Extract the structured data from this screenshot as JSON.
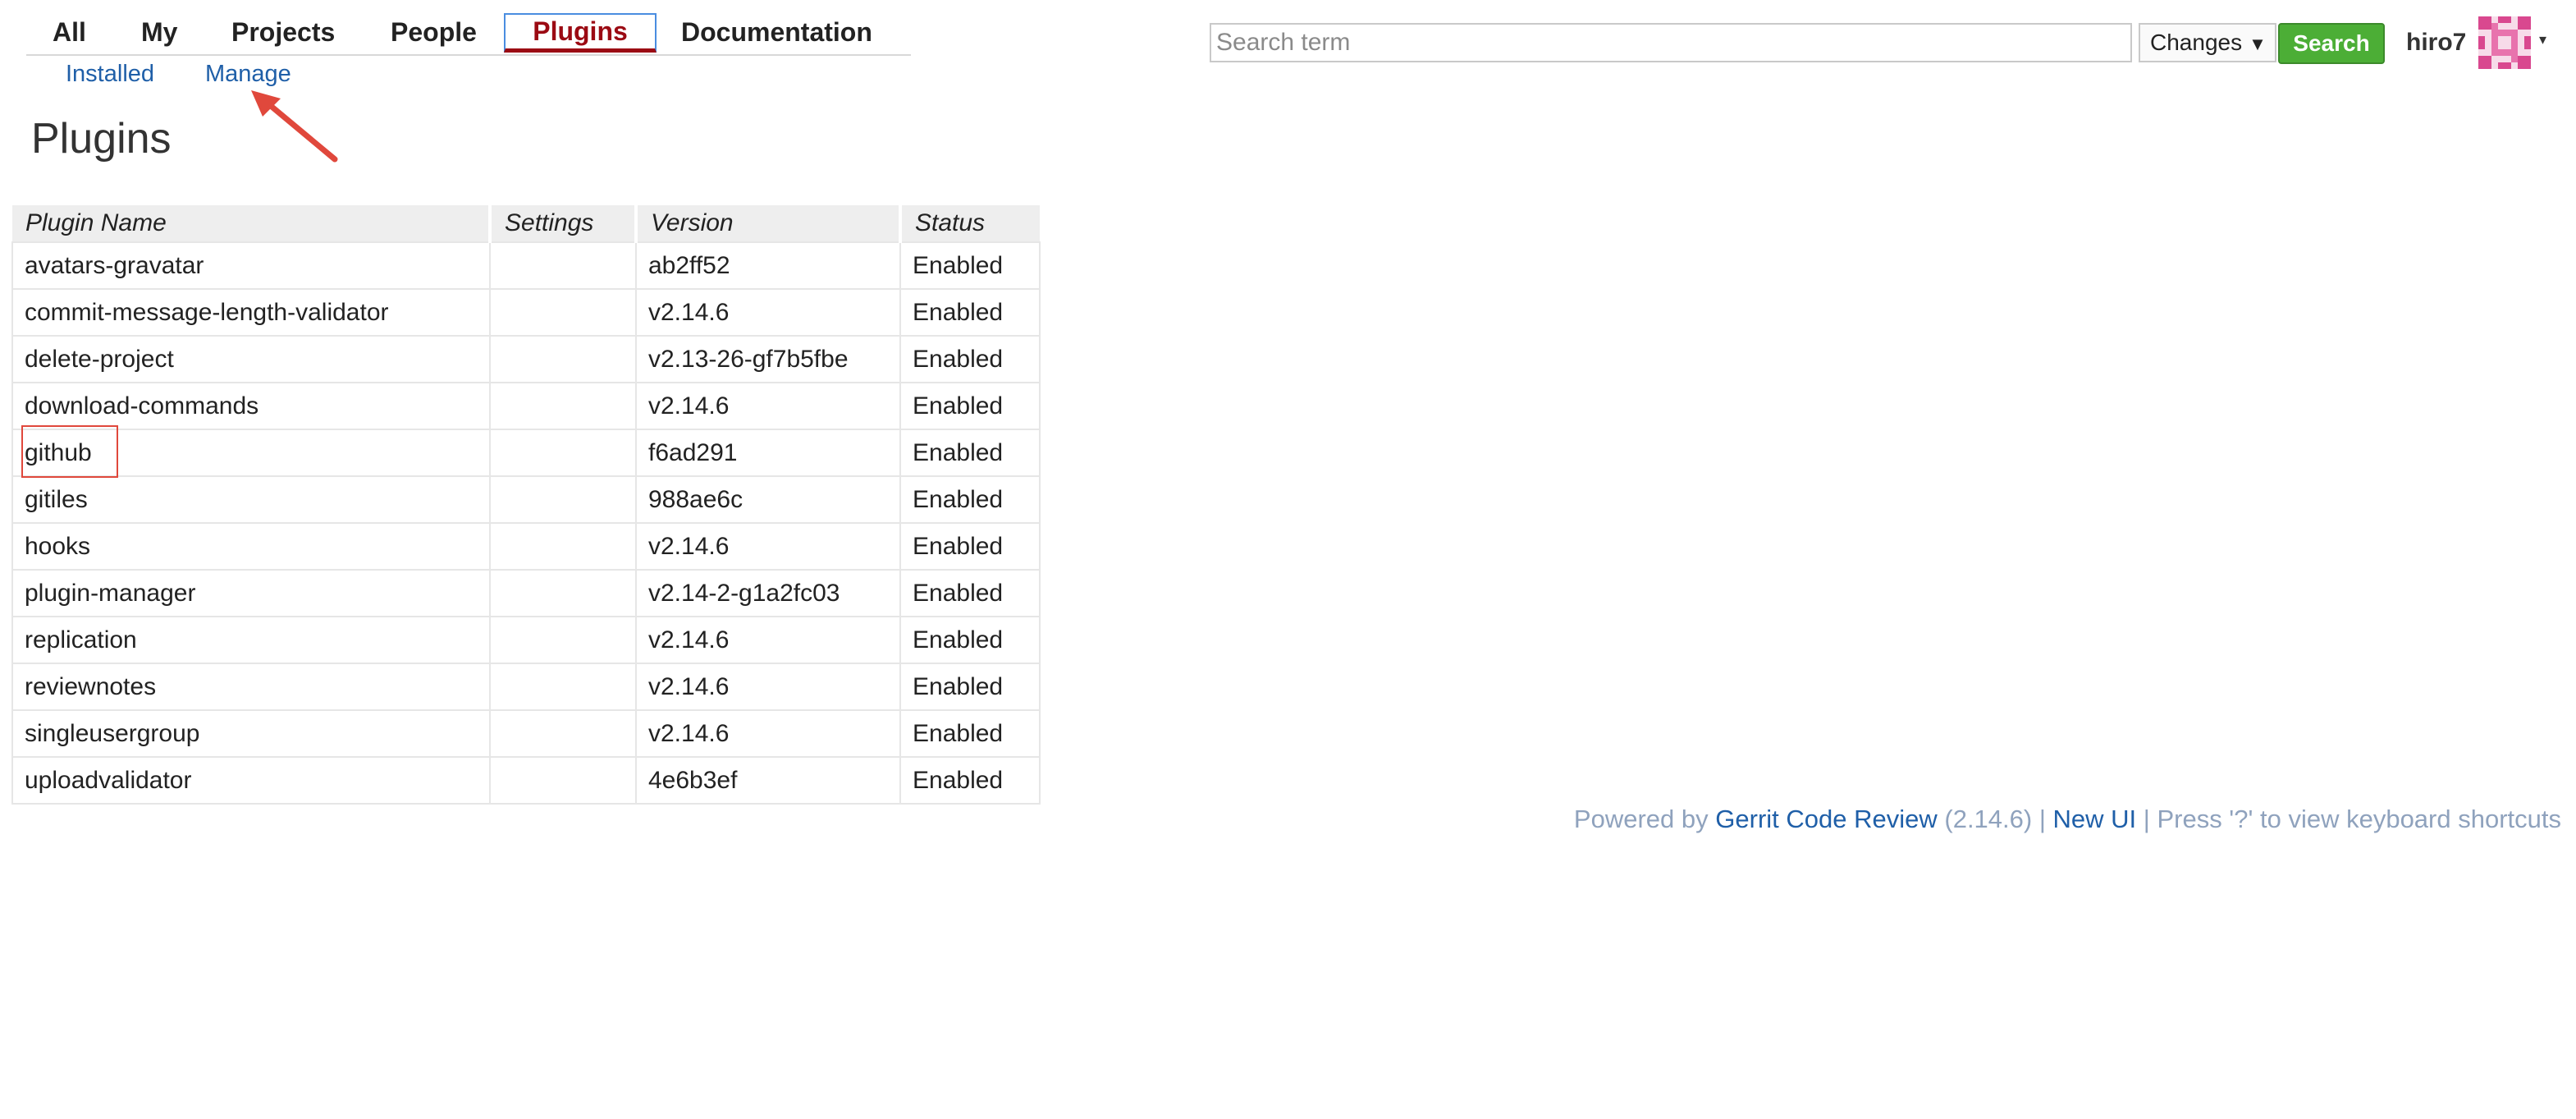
{
  "topmenu": {
    "items": [
      "All",
      "My",
      "Projects",
      "People",
      "Plugins",
      "Documentation"
    ],
    "active": "Plugins"
  },
  "submenu": {
    "items": [
      "Installed",
      "Manage"
    ]
  },
  "page": {
    "title": "Plugins"
  },
  "search": {
    "placeholder": "Search term",
    "value": "",
    "scope": "Changes",
    "button": "Search"
  },
  "user": {
    "name": "hiro7",
    "caret": "▾"
  },
  "table": {
    "headers": [
      "Plugin Name",
      "Settings",
      "Version",
      "Status"
    ],
    "rows": [
      {
        "name": "avatars-gravatar",
        "settings": "",
        "version": "ab2ff52",
        "status": "Enabled"
      },
      {
        "name": "commit-message-length-validator",
        "settings": "",
        "version": "v2.14.6",
        "status": "Enabled"
      },
      {
        "name": "delete-project",
        "settings": "",
        "version": "v2.13-26-gf7b5fbe",
        "status": "Enabled"
      },
      {
        "name": "download-commands",
        "settings": "",
        "version": "v2.14.6",
        "status": "Enabled"
      },
      {
        "name": "github",
        "settings": "",
        "version": "f6ad291",
        "status": "Enabled"
      },
      {
        "name": "gitiles",
        "settings": "",
        "version": "988ae6c",
        "status": "Enabled"
      },
      {
        "name": "hooks",
        "settings": "",
        "version": "v2.14.6",
        "status": "Enabled"
      },
      {
        "name": "plugin-manager",
        "settings": "",
        "version": "v2.14-2-g1a2fc03",
        "status": "Enabled"
      },
      {
        "name": "replication",
        "settings": "",
        "version": "v2.14.6",
        "status": "Enabled"
      },
      {
        "name": "reviewnotes",
        "settings": "",
        "version": "v2.14.6",
        "status": "Enabled"
      },
      {
        "name": "singleusergroup",
        "settings": "",
        "version": "v2.14.6",
        "status": "Enabled"
      },
      {
        "name": "uploadvalidator",
        "settings": "",
        "version": "4e6b3ef",
        "status": "Enabled"
      }
    ]
  },
  "footer": {
    "powered_by": "Powered by",
    "product_link": "Gerrit Code Review",
    "version": "(2.14.6) |",
    "new_ui_link": "New UI",
    "shortcut_hint": "| Press '?' to view keyboard shortcuts"
  },
  "colors": {
    "active_menu": "#9b0a13",
    "link": "#1f5fa8",
    "search_button": "#4cae36",
    "annotation": "#e0483c",
    "footer_text": "#8fa2bd"
  }
}
